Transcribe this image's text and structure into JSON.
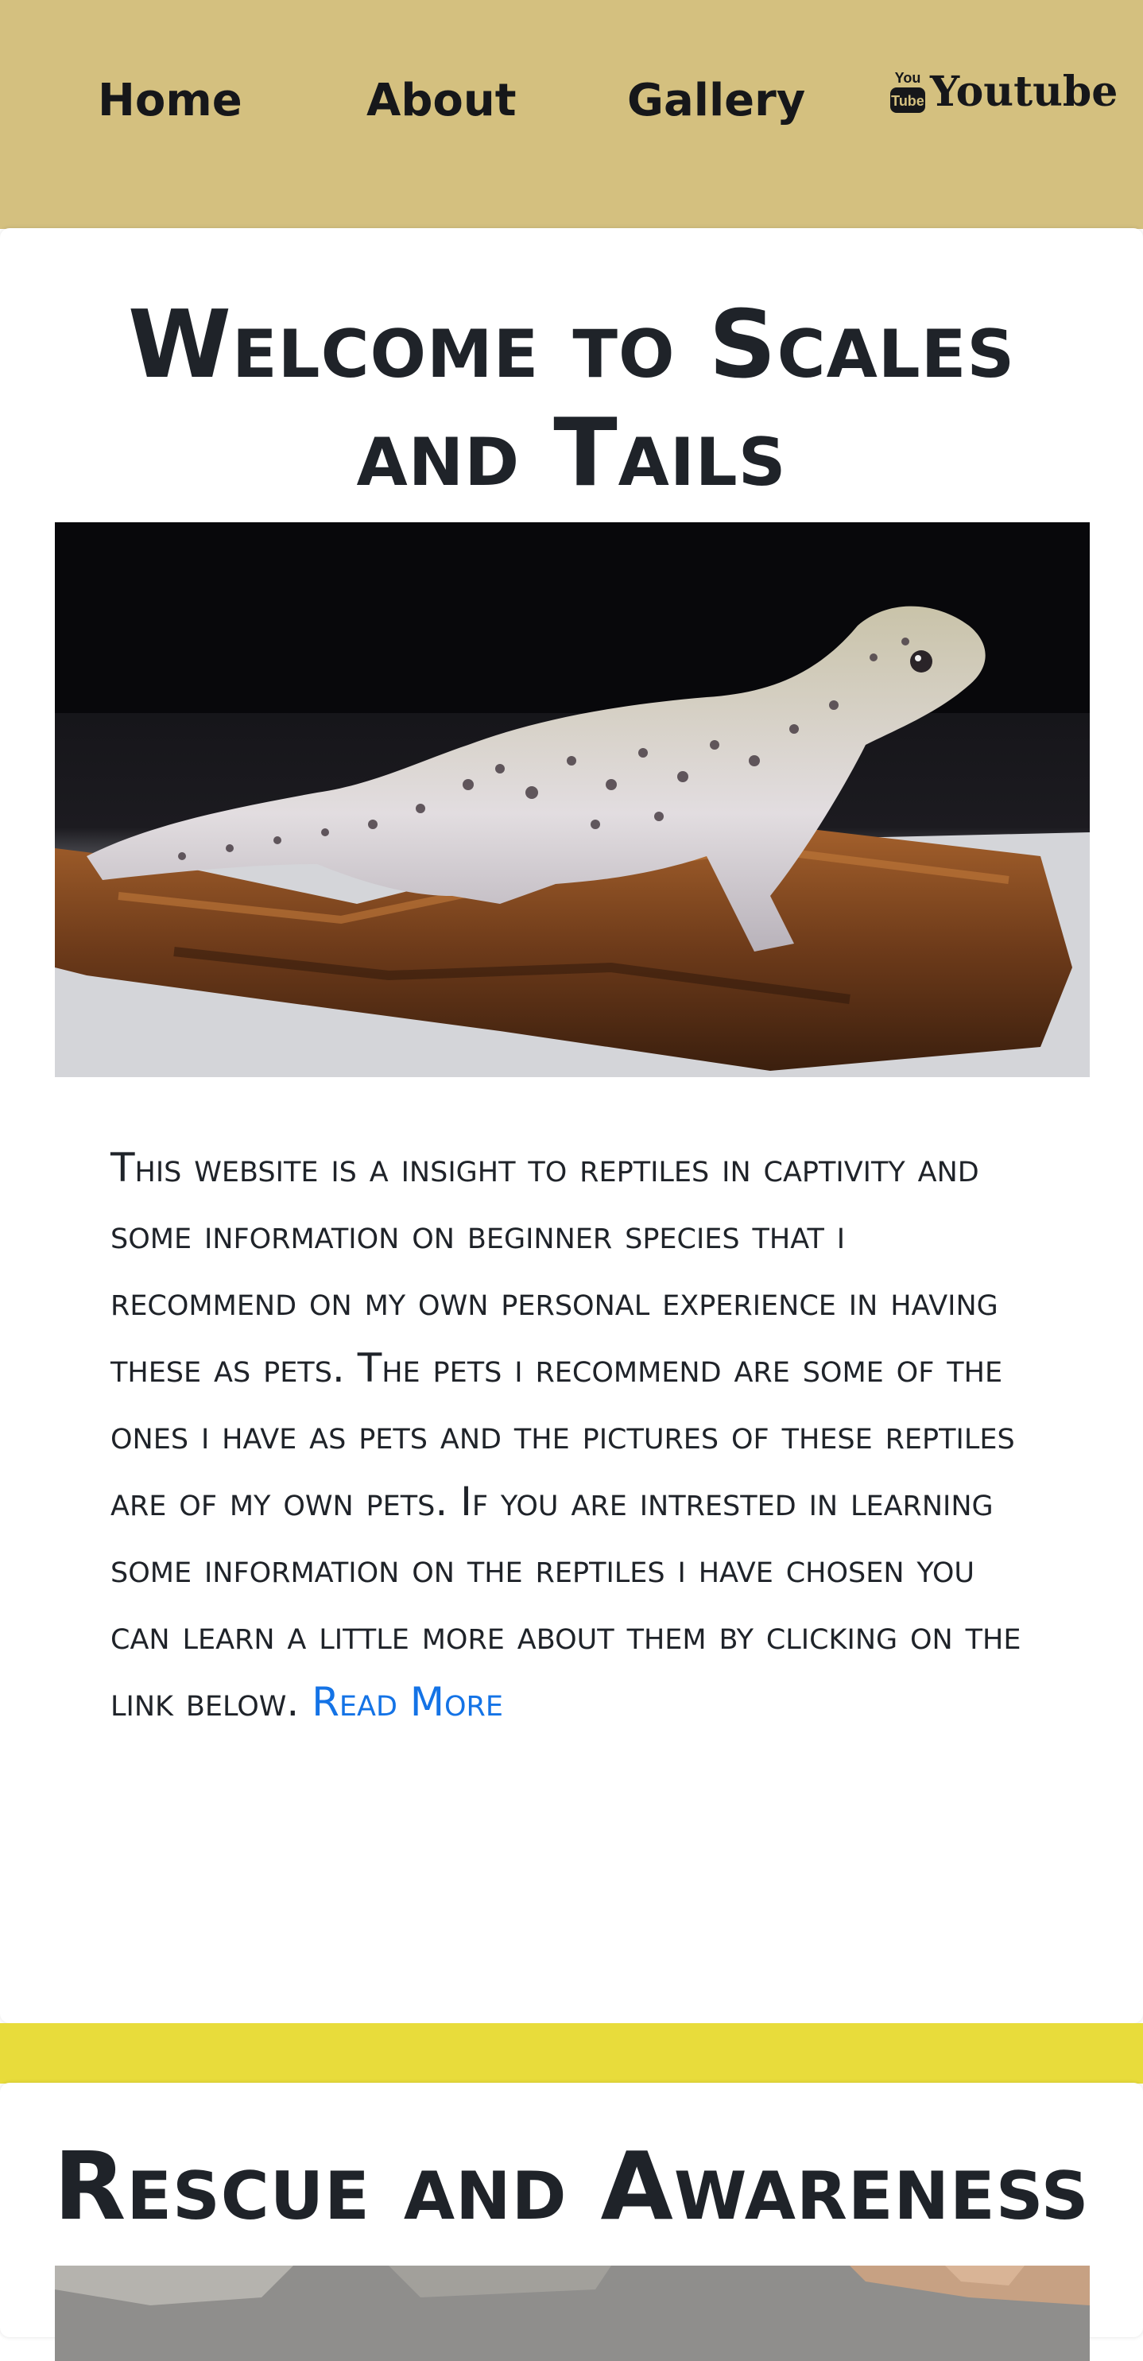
{
  "nav": {
    "home": "Home",
    "about": "About",
    "gallery": "Gallery",
    "youtube": "Youtube",
    "youtube_icon": "youtube-icon"
  },
  "welcome": {
    "title": "Welcome to Scales and Tails",
    "image": "leopard-gecko-photo",
    "intro_text": "This website is a insight to reptiles in captivity and some information on beginner species that i recommend on my own personal experience in having these as pets. The pets i recommend are some of the ones i have as pets and the pictures of these reptiles are of my own pets. If you are intrested in learning some information on the reptiles i have chosen you can learn a little more about them by clicking on the link below.",
    "read_more": "Read More"
  },
  "rescue": {
    "title": "Rescue and Awareness",
    "image": "rescue-photo"
  },
  "colors": {
    "navbar": "#d4c07f",
    "band": "#e8dc3b",
    "link": "#1473e6",
    "text": "#1f2329"
  }
}
